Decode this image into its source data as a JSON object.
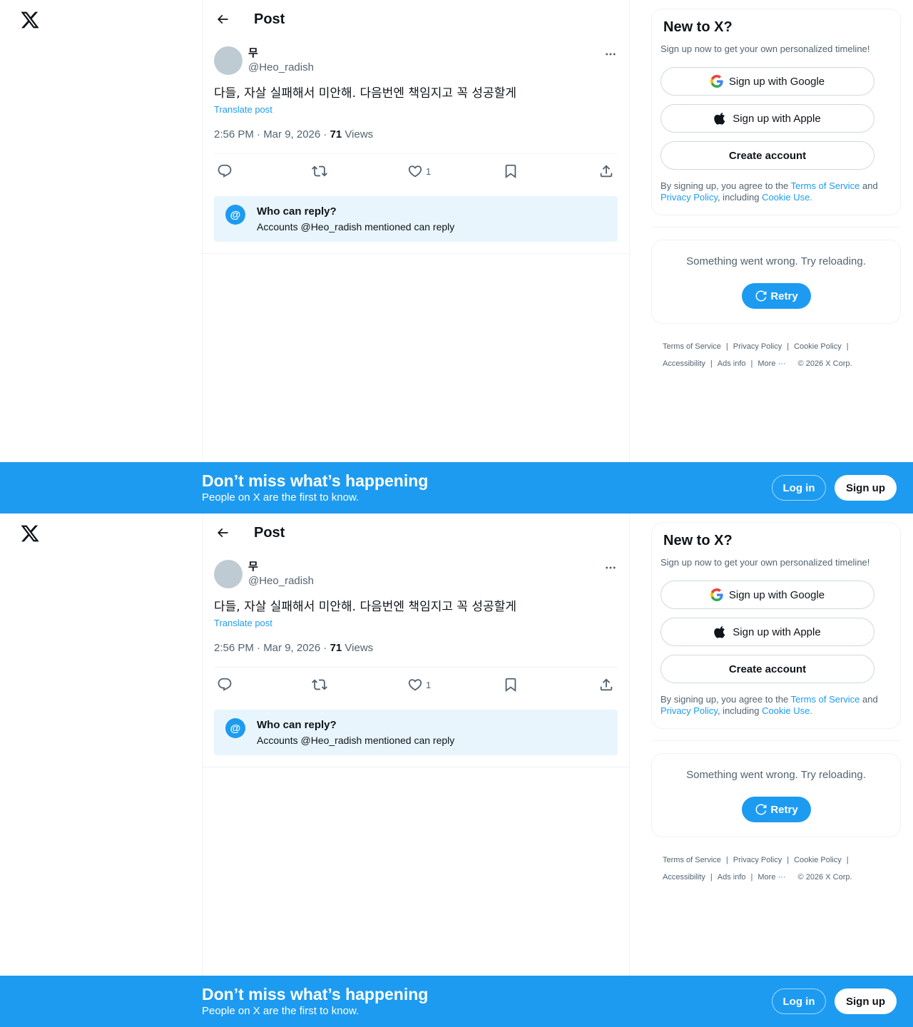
{
  "post_header": {
    "title": "Post"
  },
  "post": {
    "display_name": "무",
    "handle": "@Heo_radish",
    "text": "다들, 자살 실패해서 미안해. 다음번엔 책임지고 꼭 성공할게",
    "translate_label": "Translate post",
    "timestamp": "2:56 PM · Mar 9, 2026 · ",
    "views_count": "71",
    "views_label": " Views",
    "like_count": "1"
  },
  "who_can_reply": {
    "title": "Who can reply?",
    "subtitle": "Accounts @Heo_radish mentioned can reply",
    "icon": "@"
  },
  "sidebar": {
    "heading": "New to X?",
    "subtitle": "Sign up now to get your own personalized timeline!",
    "google_label": "Sign up with Google",
    "apple_label": "Sign up with Apple",
    "create_label": "Create account",
    "terms_prefix": "By signing up, you agree to the ",
    "terms_link": "Terms of Service",
    "terms_and": " and ",
    "privacy_link": "Privacy Policy",
    "including": ", including ",
    "cookie_link": "Cookie Use.",
    "error_text": "Something went wrong. Try reloading.",
    "retry_label": "Retry"
  },
  "footer": {
    "terms": "Terms of Service",
    "privacy": "Privacy Policy",
    "cookie": "Cookie Policy",
    "accessibility": "Accessibility",
    "ads": "Ads info",
    "more": "More ···",
    "copyright": "© 2026 X Corp.",
    "separator": "|"
  },
  "banner": {
    "title": "Don’t miss what’s happening",
    "subtitle": "People on X are the first to know.",
    "login_label": "Log in",
    "signup_label": "Sign up"
  },
  "colors": {
    "accent": "#1d9bf0",
    "text": "#0f1419",
    "muted": "#536471",
    "border": "#eff3f4",
    "reply_box_bg": "#e8f5fd",
    "avatar": "#bfcbd2"
  },
  "icons": [
    "x-logo-icon",
    "back-arrow-icon",
    "more-icon",
    "reply-icon",
    "retweet-icon",
    "heart-icon",
    "bookmark-icon",
    "share-icon",
    "at-icon",
    "google-icon",
    "apple-icon",
    "refresh-icon"
  ]
}
